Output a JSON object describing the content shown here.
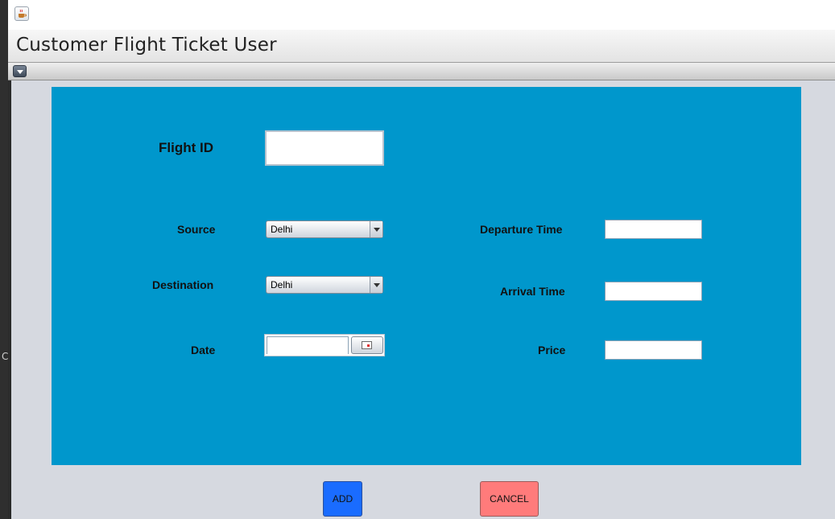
{
  "window": {
    "app_icon": "java-cup-icon",
    "title": "Customer Flight Ticket User",
    "menu_toggle_icon": "chevron-down-icon"
  },
  "form": {
    "panel_color": "#0097cc",
    "flight_id": {
      "label": "Flight ID",
      "value": ""
    },
    "source": {
      "label": "Source",
      "value": "Delhi"
    },
    "destination": {
      "label": "Destination",
      "value": "Delhi"
    },
    "date": {
      "label": "Date",
      "value": "",
      "picker_icon": "calendar-icon"
    },
    "departure_time": {
      "label": "Departure Time",
      "value": ""
    },
    "arrival_time": {
      "label": "Arrival Time",
      "value": ""
    },
    "price": {
      "label": "Price",
      "value": ""
    }
  },
  "buttons": {
    "add": {
      "label": "ADD",
      "color": "#1a6cff"
    },
    "cancel": {
      "label": "CANCEL",
      "color": "#ff7b7b"
    }
  },
  "background_glyph": "C"
}
